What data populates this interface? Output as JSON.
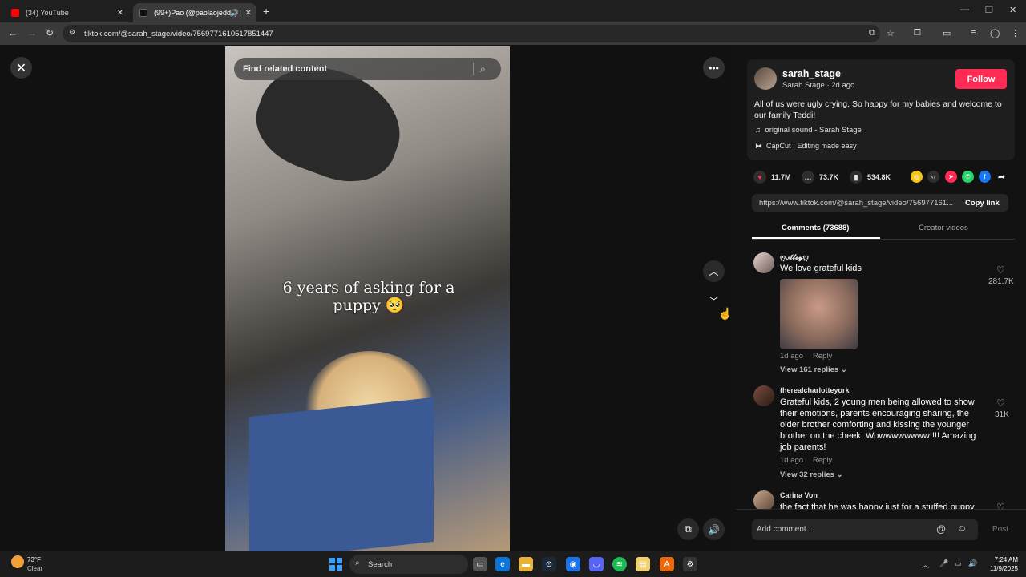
{
  "browser": {
    "tabs": [
      {
        "title": "(34) YouTube"
      },
      {
        "title": "(99+)Pao (@paolaojedda) |"
      }
    ],
    "new_tab": "+",
    "url": "tiktok.com/@sarah_stage/video/7569771610517851447"
  },
  "player": {
    "search_placeholder": "Find related content",
    "caption": "6 years of asking for a puppy 🥺"
  },
  "post": {
    "username": "sarah_stage",
    "display_line": "Sarah Stage · 2d ago",
    "follow_label": "Follow",
    "description": "All of us were ugly crying. So happy for my babies and welcome to our family Teddi!",
    "sound": "original sound - Sarah Stage",
    "capcut": "CapCut · Editing made easy",
    "likes": "11.7M",
    "comments": "73.7K",
    "saves": "534.8K",
    "link": "https://www.tiktok.com/@sarah_stage/video/756977161...",
    "copy_link": "Copy link",
    "tab_comments": "Comments (73688)",
    "tab_creator": "Creator videos"
  },
  "comments": [
    {
      "name": "ღ𝓐𝓵𝓮𝔂ღ",
      "text": "We love grateful kids",
      "meta": "1d ago",
      "reply": "Reply",
      "replies": "View 161 replies ⌄",
      "likes": "281.7K"
    },
    {
      "name": "therealcharlotteyork",
      "text": "Grateful kids, 2 young men being allowed to show their emotions, parents encouraging sharing, the older brother comforting and kissing the younger brother on the cheek. Wowwwwwwww!!!! Amazing job parents!",
      "meta": "1d ago",
      "reply": "Reply",
      "replies": "View 32 replies ⌄",
      "likes": "31K"
    },
    {
      "name": "Carina Von",
      "text": "the fact that he was happy just for a stuffed puppy"
    }
  ],
  "composer": {
    "placeholder": "Add comment...",
    "post_label": "Post"
  },
  "taskbar": {
    "temp": "73°F",
    "condition": "Clear",
    "search": "Search",
    "time": "7:24 AM",
    "date": "11/9/2025"
  },
  "colors": {
    "accent": "#fe2c55",
    "panel": "#121212"
  }
}
